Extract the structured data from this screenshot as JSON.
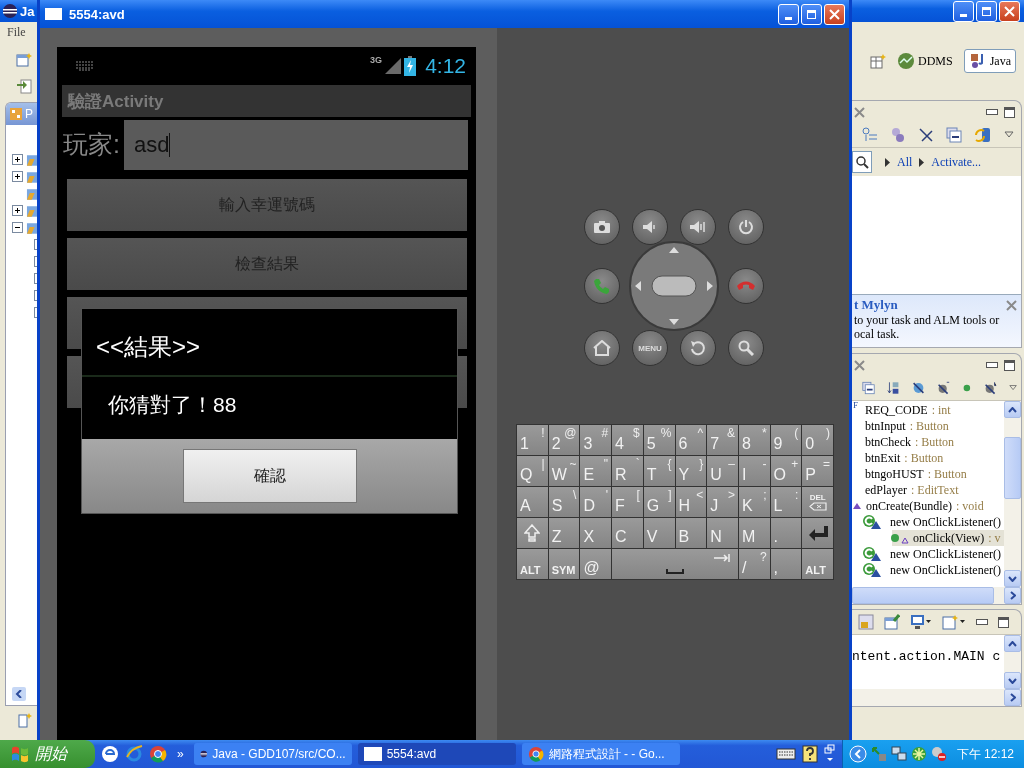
{
  "eclipse": {
    "title": "Ja",
    "menu": [
      "File"
    ],
    "package_explorer": {
      "tab": "P",
      "nodes": [
        {
          "expanded": false
        },
        {
          "expanded": false
        },
        {
          "kind": "leaf"
        },
        {
          "expanded": false
        },
        {
          "expanded": true
        }
      ]
    },
    "perspectives": [
      {
        "label": "DDMS",
        "selected": false
      },
      {
        "label": "Java",
        "selected": true
      }
    ],
    "task_list": {
      "filters": [
        "All",
        "Activate..."
      ],
      "mylyn": {
        "title": "t Mylyn",
        "lines": [
          "to your task and ALM tools or",
          "ocal task."
        ]
      }
    },
    "outline": [
      {
        "kind": "field",
        "modifier": "F",
        "name": "REQ_CODE",
        "type": ": int",
        "selected": false
      },
      {
        "kind": "field",
        "name": "btnInput",
        "type": ": Button",
        "selected": false
      },
      {
        "kind": "field",
        "name": "btnCheck",
        "type": ": Button",
        "selected": false
      },
      {
        "kind": "field",
        "name": "btnExit",
        "type": ": Button",
        "selected": false
      },
      {
        "kind": "field",
        "name": "btngoHUST",
        "type": ": Button",
        "selected": false
      },
      {
        "kind": "field",
        "name": "edPlayer",
        "type": ": EditText",
        "selected": false
      },
      {
        "kind": "method",
        "name": "onCreate(Bundle)",
        "type": ": void",
        "selected": false,
        "children": [
          {
            "kind": "class",
            "name": "new OnClickListener()",
            "selected": false,
            "children": [
              {
                "kind": "method",
                "name": "onClick(View)",
                "type": ": v",
                "selected": true
              }
            ]
          },
          {
            "kind": "class",
            "name": "new OnClickListener()",
            "selected": false
          },
          {
            "kind": "class",
            "name": "new OnClickListener()",
            "selected": false
          }
        ]
      }
    ],
    "console": {
      "text": "ntent.action.MAIN c"
    }
  },
  "emulator": {
    "title": "5554:avd",
    "status_bar": {
      "network": "3G",
      "time": "4:12"
    },
    "app": {
      "title": "驗證Activity",
      "player_label": "玩家:",
      "player_value": "asd",
      "buttons": [
        "輸入幸運號碼",
        "檢查結果"
      ]
    },
    "dialog": {
      "title": "<<結果>>",
      "message": "你猜對了！88",
      "button": "確認"
    },
    "hardware_buttons": {
      "menu": "MENU"
    },
    "keyboard": [
      [
        {
          "kind": "char",
          "main": "1",
          "alt": "!"
        },
        {
          "kind": "char",
          "main": "2",
          "alt": "@"
        },
        {
          "kind": "char",
          "main": "3",
          "alt": "#"
        },
        {
          "kind": "char",
          "main": "4",
          "alt": "$"
        },
        {
          "kind": "char",
          "main": "5",
          "alt": "%"
        },
        {
          "kind": "char",
          "main": "6",
          "alt": "^"
        },
        {
          "kind": "char",
          "main": "7",
          "alt": "&"
        },
        {
          "kind": "char",
          "main": "8",
          "alt": "*"
        },
        {
          "kind": "char",
          "main": "9",
          "alt": "("
        },
        {
          "kind": "char",
          "main": "0",
          "alt": ")"
        }
      ],
      [
        {
          "kind": "char",
          "main": "Q",
          "alt": "|"
        },
        {
          "kind": "char",
          "main": "W",
          "alt": "~"
        },
        {
          "kind": "char",
          "main": "E",
          "alt": "\""
        },
        {
          "kind": "char",
          "main": "R",
          "alt": "`"
        },
        {
          "kind": "char",
          "main": "T",
          "alt": "{"
        },
        {
          "kind": "char",
          "main": "Y",
          "alt": "}"
        },
        {
          "kind": "char",
          "main": "U",
          "alt": "–"
        },
        {
          "kind": "char",
          "main": "I",
          "alt": "-"
        },
        {
          "kind": "char",
          "main": "O",
          "alt": "+"
        },
        {
          "kind": "char",
          "main": "P",
          "alt": "="
        }
      ],
      [
        {
          "kind": "char",
          "main": "A"
        },
        {
          "kind": "char",
          "main": "S",
          "alt": "\\"
        },
        {
          "kind": "char",
          "main": "D",
          "alt": "'"
        },
        {
          "kind": "char",
          "main": "F",
          "alt": "["
        },
        {
          "kind": "char",
          "main": "G",
          "alt": "]"
        },
        {
          "kind": "char",
          "main": "H",
          "alt": "<"
        },
        {
          "kind": "char",
          "main": "J",
          "alt": ">"
        },
        {
          "kind": "char",
          "main": "K",
          "alt": ";"
        },
        {
          "kind": "char",
          "main": "L",
          "alt": ":"
        },
        {
          "kind": "del",
          "main": "DEL"
        }
      ],
      [
        {
          "kind": "shift"
        },
        {
          "kind": "char",
          "main": "Z"
        },
        {
          "kind": "char",
          "main": "X"
        },
        {
          "kind": "char",
          "main": "C"
        },
        {
          "kind": "char",
          "main": "V"
        },
        {
          "kind": "char",
          "main": "B"
        },
        {
          "kind": "char",
          "main": "N"
        },
        {
          "kind": "char",
          "main": "M"
        },
        {
          "kind": "char",
          "main": "."
        },
        {
          "kind": "enter"
        }
      ],
      [
        {
          "kind": "mod",
          "main": "ALT"
        },
        {
          "kind": "mod",
          "main": "SYM"
        },
        {
          "kind": "char",
          "main": "@"
        },
        {
          "kind": "space"
        },
        {
          "kind": "char",
          "main": "/",
          "alt": "?"
        },
        {
          "kind": "char",
          "main": ","
        },
        {
          "kind": "mod",
          "main": "ALT"
        }
      ]
    ]
  },
  "taskbar": {
    "start": "開始",
    "more": "»",
    "tasks": [
      {
        "kind": "eclipse",
        "label": "Java - GDD107/src/CO...",
        "selected": false
      },
      {
        "kind": "window",
        "label": "5554:avd",
        "selected": true
      },
      {
        "kind": "browser",
        "label": "網路程式設計 - - Go...",
        "selected": false
      }
    ],
    "clock": "下午 12:12"
  }
}
